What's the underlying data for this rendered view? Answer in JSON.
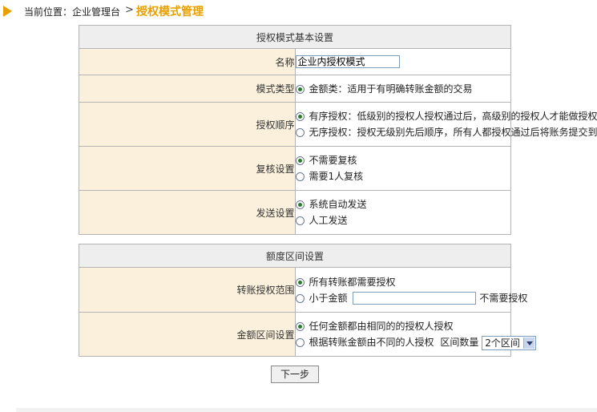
{
  "breadcrumb": {
    "location_label": "当前位置：企业管理台",
    "separator": ">",
    "current": "授权模式管理"
  },
  "basic_settings": {
    "title": "授权模式基本设置",
    "name": {
      "label": "名称",
      "value": "企业内授权模式"
    },
    "mode_type": {
      "label": "模式类型",
      "option": "金额类：适用于有明确转账金额的交易",
      "selected": true
    },
    "auth_order": {
      "label": "授权顺序",
      "options": [
        {
          "text": "有序授权：低级别的授权人授权通过后，高级别的授权人才能做授权",
          "selected": true
        },
        {
          "text": "无序授权：授权无级别先后顺序，所有人都授权通过后将账务提交到银行",
          "selected": false
        }
      ]
    },
    "review": {
      "label": "复核设置",
      "options": [
        {
          "text": "不需要复核",
          "selected": true
        },
        {
          "text": "需要1人复核",
          "selected": false
        }
      ]
    },
    "send": {
      "label": "发送设置",
      "options": [
        {
          "text": "系统自动发送",
          "selected": true
        },
        {
          "text": "人工发送",
          "selected": false
        }
      ]
    }
  },
  "amount_settings": {
    "title": "额度区间设置",
    "scope": {
      "label": "转账授权范围",
      "option_all": "所有转账都需要授权",
      "option_less_prefix": "小于金额",
      "option_less_suffix": "不需要授权",
      "amount_value": ""
    },
    "range": {
      "label": "金额区间设置",
      "option_same": "任何金额都由相同的的授权人授权",
      "option_diff": "根据转账金额由不同的人授权",
      "count_label": "区间数量",
      "count_value": "2个区间"
    }
  },
  "next_button": "下一步"
}
